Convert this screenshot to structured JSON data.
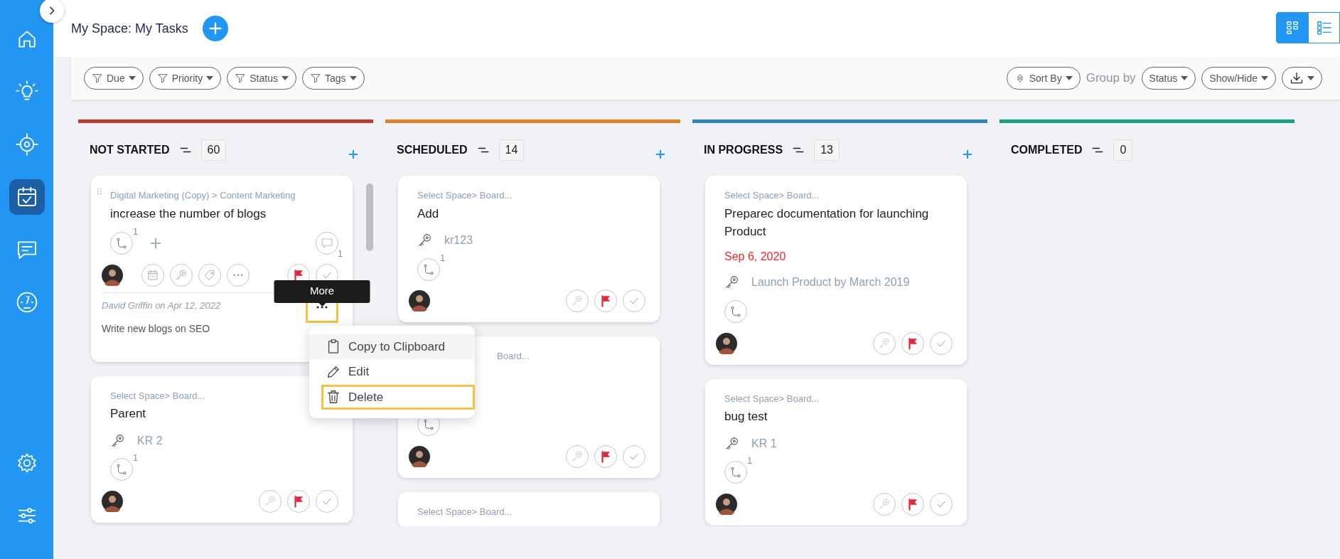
{
  "sidebar": {
    "items": [
      {
        "selected": false
      },
      {
        "selected": false
      },
      {
        "selected": false
      },
      {
        "selected": true
      },
      {
        "selected": false
      },
      {
        "selected": false
      }
    ],
    "bottom_items": [
      {
        "selected": false
      },
      {
        "selected": false
      }
    ]
  },
  "page": {
    "title": "My Space: My Tasks"
  },
  "view_toggle": [
    {
      "selected": true
    },
    {
      "selected": false
    }
  ],
  "filters": [
    {
      "label": "Due"
    },
    {
      "label": "Priority"
    },
    {
      "label": "Status"
    },
    {
      "label": "Tags"
    }
  ],
  "sort": {
    "label": "Sort By"
  },
  "group_by": {
    "label": "Group by",
    "value": "Status"
  },
  "show_hide": {
    "label": "Show/Hide"
  },
  "columns": [
    {
      "title": "NOT STARTED",
      "count": "60",
      "color": "#c0392b",
      "can_add": true,
      "scrollable": true,
      "cards": [
        {
          "kind": "expanded",
          "breadcrumb": "Digital Marketing (Copy) > Content Marketing",
          "title": "increase the number of blogs",
          "subtask_count": "1",
          "comment_count": "1",
          "flagged": true,
          "comment": {
            "meta": "David Griffin on Apr 12, 2022",
            "text": "Write new blogs on SEO",
            "more_highlighted": true
          }
        },
        {
          "kind": "compact",
          "breadcrumb": "Select Space> Board...",
          "title": "Parent",
          "key_result": "KR 2",
          "subtask_count": "1",
          "flagged": true
        }
      ]
    },
    {
      "title": "SCHEDULED",
      "count": "14",
      "color": "#e67e22",
      "can_add": true,
      "cards": [
        {
          "kind": "compact",
          "breadcrumb": "Select Space> Board...",
          "title": "Add",
          "key_result": "kr123",
          "subtask_count": "1",
          "flagged": true
        },
        {
          "kind": "covered",
          "breadcrumb": "Board...",
          "flagged": true
        },
        {
          "kind": "stub",
          "breadcrumb": "Select Space> Board..."
        }
      ]
    },
    {
      "title": "IN PROGRESS",
      "count": "13",
      "color": "#2e86c1",
      "can_add": true,
      "cards": [
        {
          "kind": "compact",
          "breadcrumb": "Select Space> Board...",
          "title": "Preparec documentation for launching Product",
          "due": "Sep 6, 2020",
          "key_result": "Launch Product by March 2019",
          "flagged": true
        },
        {
          "kind": "compact",
          "breadcrumb": "Select Space> Board...",
          "title": "bug test",
          "key_result": "KR 1",
          "subtask_count": "1",
          "flagged": true
        }
      ]
    },
    {
      "title": "COMPLETED",
      "count": "0",
      "color": "#16a085"
    }
  ],
  "tooltip": {
    "label": "More"
  },
  "menu": {
    "items": [
      {
        "label": "Copy to Clipboard",
        "hovered": true,
        "highlighted": false
      },
      {
        "label": "Edit",
        "hovered": false,
        "highlighted": false
      },
      {
        "label": "Delete",
        "hovered": false,
        "highlighted": true
      }
    ]
  }
}
